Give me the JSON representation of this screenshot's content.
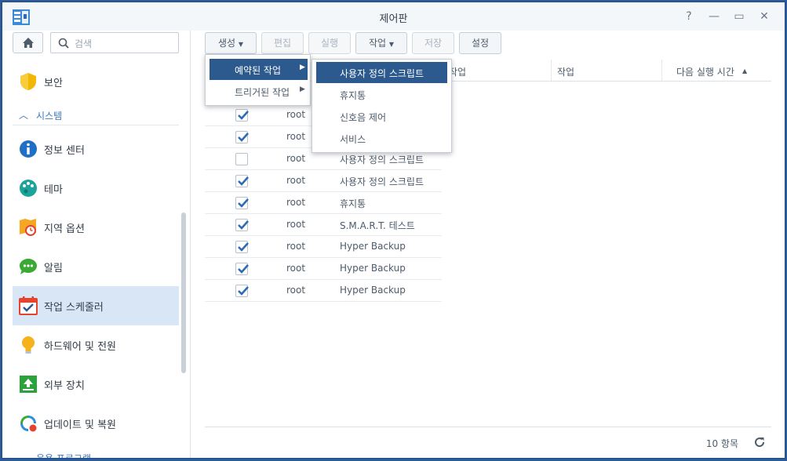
{
  "window": {
    "title": "제어판"
  },
  "sidebar": {
    "search_placeholder": "검색",
    "items": [
      {
        "label": "보안"
      },
      {
        "label": "정보 센터"
      },
      {
        "label": "테마"
      },
      {
        "label": "지역 옵션"
      },
      {
        "label": "알림"
      },
      {
        "label": "작업 스케줄러"
      },
      {
        "label": "하드웨어 및 전원"
      },
      {
        "label": "외부 장치"
      },
      {
        "label": "업데이트 및 복원"
      }
    ],
    "section_system": "시스템",
    "section_apps": "응용 프로그램"
  },
  "toolbar": {
    "create": "생성",
    "edit": "편집",
    "run": "실행",
    "action": "작업",
    "save": "저장",
    "settings": "설정"
  },
  "grid": {
    "headers": {
      "col_task_partial": "작업",
      "col_action": "작업",
      "col_next_run": "다음 실행 시간"
    },
    "rows": [
      {
        "checked": true,
        "owner": "root",
        "task": ""
      },
      {
        "checked": true,
        "owner": "root",
        "task": ""
      },
      {
        "checked": false,
        "owner": "root",
        "task": "사용자 정의 스크립트"
      },
      {
        "checked": true,
        "owner": "root",
        "task": "사용자 정의 스크립트"
      },
      {
        "checked": true,
        "owner": "root",
        "task": "휴지통"
      },
      {
        "checked": true,
        "owner": "root",
        "task": "S.M.A.R.T. 테스트"
      },
      {
        "checked": true,
        "owner": "root",
        "task": "Hyper Backup"
      },
      {
        "checked": true,
        "owner": "root",
        "task": "Hyper Backup"
      },
      {
        "checked": true,
        "owner": "root",
        "task": "Hyper Backup"
      }
    ],
    "item_count": "10 항목"
  },
  "menu_create": {
    "items": [
      {
        "label": "예약된 작업"
      },
      {
        "label": "트리거된 작업"
      }
    ]
  },
  "submenu_scheduled": {
    "items": [
      {
        "label": "사용자 정의 스크립트"
      },
      {
        "label": "휴지통"
      },
      {
        "label": "신호음 제어"
      },
      {
        "label": "서비스"
      }
    ]
  },
  "colors": {
    "accent": "#2d5a8e",
    "selection": "#d8e6f6",
    "check": "#2e6bb0"
  }
}
